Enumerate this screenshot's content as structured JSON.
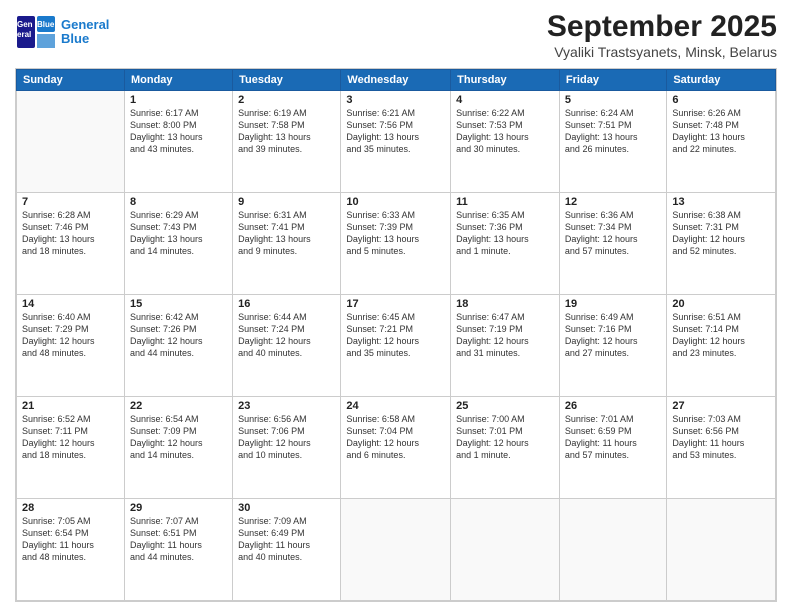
{
  "header": {
    "logo_line1": "General",
    "logo_line2": "Blue",
    "title": "September 2025",
    "subtitle": "Vyaliki Trastsyanets, Minsk, Belarus"
  },
  "days_of_week": [
    "Sunday",
    "Monday",
    "Tuesday",
    "Wednesday",
    "Thursday",
    "Friday",
    "Saturday"
  ],
  "weeks": [
    [
      {
        "day": "",
        "detail": ""
      },
      {
        "day": "1",
        "detail": "Sunrise: 6:17 AM\nSunset: 8:00 PM\nDaylight: 13 hours\nand 43 minutes."
      },
      {
        "day": "2",
        "detail": "Sunrise: 6:19 AM\nSunset: 7:58 PM\nDaylight: 13 hours\nand 39 minutes."
      },
      {
        "day": "3",
        "detail": "Sunrise: 6:21 AM\nSunset: 7:56 PM\nDaylight: 13 hours\nand 35 minutes."
      },
      {
        "day": "4",
        "detail": "Sunrise: 6:22 AM\nSunset: 7:53 PM\nDaylight: 13 hours\nand 30 minutes."
      },
      {
        "day": "5",
        "detail": "Sunrise: 6:24 AM\nSunset: 7:51 PM\nDaylight: 13 hours\nand 26 minutes."
      },
      {
        "day": "6",
        "detail": "Sunrise: 6:26 AM\nSunset: 7:48 PM\nDaylight: 13 hours\nand 22 minutes."
      }
    ],
    [
      {
        "day": "7",
        "detail": "Sunrise: 6:28 AM\nSunset: 7:46 PM\nDaylight: 13 hours\nand 18 minutes."
      },
      {
        "day": "8",
        "detail": "Sunrise: 6:29 AM\nSunset: 7:43 PM\nDaylight: 13 hours\nand 14 minutes."
      },
      {
        "day": "9",
        "detail": "Sunrise: 6:31 AM\nSunset: 7:41 PM\nDaylight: 13 hours\nand 9 minutes."
      },
      {
        "day": "10",
        "detail": "Sunrise: 6:33 AM\nSunset: 7:39 PM\nDaylight: 13 hours\nand 5 minutes."
      },
      {
        "day": "11",
        "detail": "Sunrise: 6:35 AM\nSunset: 7:36 PM\nDaylight: 13 hours\nand 1 minute."
      },
      {
        "day": "12",
        "detail": "Sunrise: 6:36 AM\nSunset: 7:34 PM\nDaylight: 12 hours\nand 57 minutes."
      },
      {
        "day": "13",
        "detail": "Sunrise: 6:38 AM\nSunset: 7:31 PM\nDaylight: 12 hours\nand 52 minutes."
      }
    ],
    [
      {
        "day": "14",
        "detail": "Sunrise: 6:40 AM\nSunset: 7:29 PM\nDaylight: 12 hours\nand 48 minutes."
      },
      {
        "day": "15",
        "detail": "Sunrise: 6:42 AM\nSunset: 7:26 PM\nDaylight: 12 hours\nand 44 minutes."
      },
      {
        "day": "16",
        "detail": "Sunrise: 6:44 AM\nSunset: 7:24 PM\nDaylight: 12 hours\nand 40 minutes."
      },
      {
        "day": "17",
        "detail": "Sunrise: 6:45 AM\nSunset: 7:21 PM\nDaylight: 12 hours\nand 35 minutes."
      },
      {
        "day": "18",
        "detail": "Sunrise: 6:47 AM\nSunset: 7:19 PM\nDaylight: 12 hours\nand 31 minutes."
      },
      {
        "day": "19",
        "detail": "Sunrise: 6:49 AM\nSunset: 7:16 PM\nDaylight: 12 hours\nand 27 minutes."
      },
      {
        "day": "20",
        "detail": "Sunrise: 6:51 AM\nSunset: 7:14 PM\nDaylight: 12 hours\nand 23 minutes."
      }
    ],
    [
      {
        "day": "21",
        "detail": "Sunrise: 6:52 AM\nSunset: 7:11 PM\nDaylight: 12 hours\nand 18 minutes."
      },
      {
        "day": "22",
        "detail": "Sunrise: 6:54 AM\nSunset: 7:09 PM\nDaylight: 12 hours\nand 14 minutes."
      },
      {
        "day": "23",
        "detail": "Sunrise: 6:56 AM\nSunset: 7:06 PM\nDaylight: 12 hours\nand 10 minutes."
      },
      {
        "day": "24",
        "detail": "Sunrise: 6:58 AM\nSunset: 7:04 PM\nDaylight: 12 hours\nand 6 minutes."
      },
      {
        "day": "25",
        "detail": "Sunrise: 7:00 AM\nSunset: 7:01 PM\nDaylight: 12 hours\nand 1 minute."
      },
      {
        "day": "26",
        "detail": "Sunrise: 7:01 AM\nSunset: 6:59 PM\nDaylight: 11 hours\nand 57 minutes."
      },
      {
        "day": "27",
        "detail": "Sunrise: 7:03 AM\nSunset: 6:56 PM\nDaylight: 11 hours\nand 53 minutes."
      }
    ],
    [
      {
        "day": "28",
        "detail": "Sunrise: 7:05 AM\nSunset: 6:54 PM\nDaylight: 11 hours\nand 48 minutes."
      },
      {
        "day": "29",
        "detail": "Sunrise: 7:07 AM\nSunset: 6:51 PM\nDaylight: 11 hours\nand 44 minutes."
      },
      {
        "day": "30",
        "detail": "Sunrise: 7:09 AM\nSunset: 6:49 PM\nDaylight: 11 hours\nand 40 minutes."
      },
      {
        "day": "",
        "detail": ""
      },
      {
        "day": "",
        "detail": ""
      },
      {
        "day": "",
        "detail": ""
      },
      {
        "day": "",
        "detail": ""
      }
    ]
  ]
}
